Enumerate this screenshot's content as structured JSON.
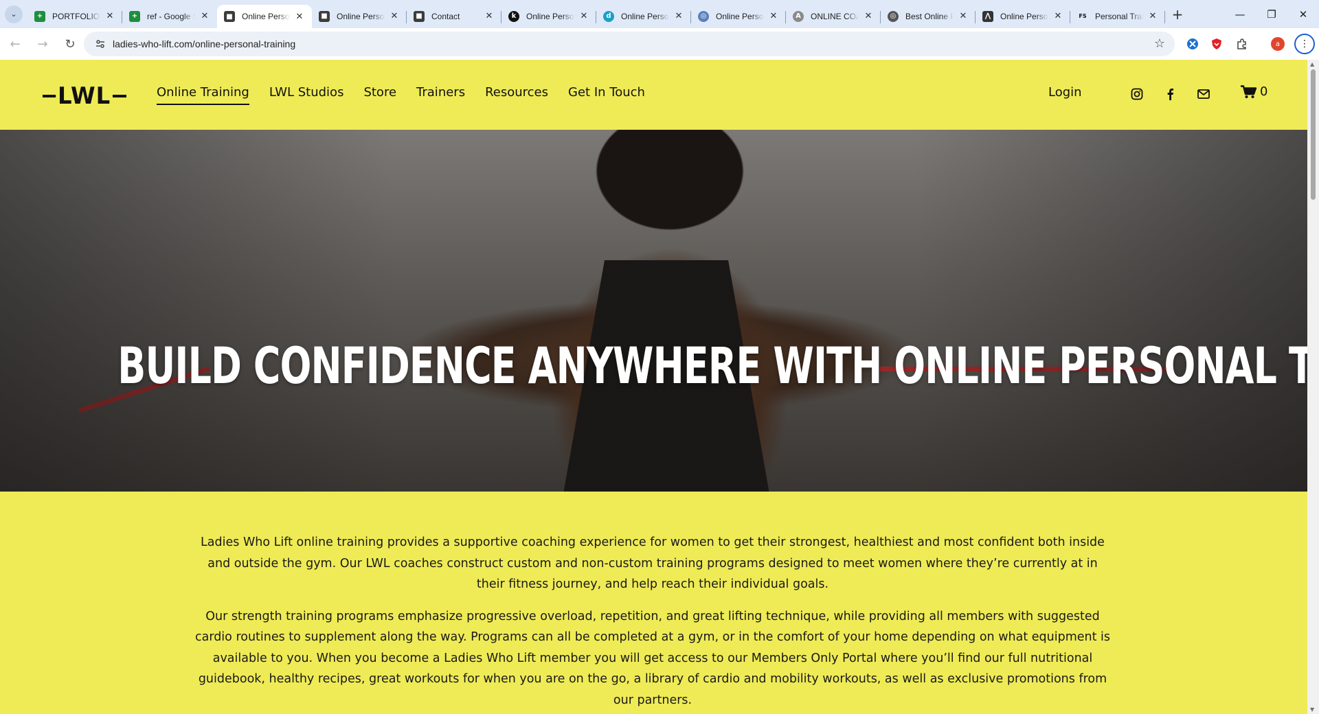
{
  "browser": {
    "tabs": [
      {
        "title": "PORTFOLIO - Google Sheets",
        "icon": "sheets-icon",
        "color": "#1e8e3e",
        "glyph": "+"
      },
      {
        "title": "ref - Google Sheets",
        "icon": "sheets-icon",
        "color": "#1e8e3e",
        "glyph": "+"
      },
      {
        "title": "Online Personal Training",
        "icon": "squarespace-cube-icon",
        "color": "#3c3c3c",
        "glyph": "■",
        "active": true
      },
      {
        "title": "Online Personal Training",
        "icon": "squarespace-cube-icon",
        "color": "#3c3c3c",
        "glyph": "■"
      },
      {
        "title": "Contact",
        "icon": "squarespace-cube-icon",
        "color": "#3c3c3c",
        "glyph": "■"
      },
      {
        "title": "Online Personal Training",
        "icon": "k-circle-icon",
        "color": "#111111",
        "glyph": "k"
      },
      {
        "title": "Online Personal Training",
        "icon": "teal-circle-icon",
        "color": "#1a9fc6",
        "glyph": "d"
      },
      {
        "title": "Online Personal Training",
        "icon": "globe-icon",
        "color": "#5b7fbf",
        "glyph": "◎"
      },
      {
        "title": "ONLINE COACHING",
        "icon": "a-circle-icon",
        "color": "#8a8a8a",
        "glyph": "A"
      },
      {
        "title": "Best Online Personal Trainers",
        "icon": "globe-icon",
        "color": "#555555",
        "glyph": "◎"
      },
      {
        "title": "Online Personal Training",
        "icon": "mountain-icon",
        "color": "#333333",
        "glyph": "⋀"
      },
      {
        "title": "Personal Training",
        "icon": "fs-icon",
        "color": "#111111",
        "glyph": "FS"
      }
    ],
    "url": "ladies-who-lift.com/online-personal-training",
    "profile_initial": "a"
  },
  "site": {
    "logo": "LWL",
    "nav": [
      "Online Training",
      "LWL Studios",
      "Store",
      "Trainers",
      "Resources",
      "Get In Touch"
    ],
    "login": "Login",
    "cart_count": "0"
  },
  "hero": {
    "title": "BUILD CONFIDENCE ANYWHERE WITH ONLINE PERSONAL TRAINING"
  },
  "intro": {
    "paragraph1": "Ladies Who Lift online training provides a supportive coaching experience for women to get their strongest, healthiest and most confident both inside and outside the gym. Our LWL coaches construct custom and non-custom training programs designed to meet women where they’re currently at in their fitness journey, and help reach their individual goals.",
    "paragraph2": "Our strength training programs emphasize progressive overload, repetition, and great lifting technique, while providing all members with suggested cardio routines to supplement along the way. Programs can all be completed at a gym, or in the comfort of your home depending on what equipment is available to you. When you become a Ladies Who Lift member you will get access to our Members Only Portal where you’ll find our full nutritional guidebook, healthy recipes, great workouts for when you are on the go, a library of cardio and mobility workouts, as well as exclusive promotions from our partners."
  },
  "colors": {
    "brand_yellow": "#efeb56",
    "text": "#111111"
  }
}
